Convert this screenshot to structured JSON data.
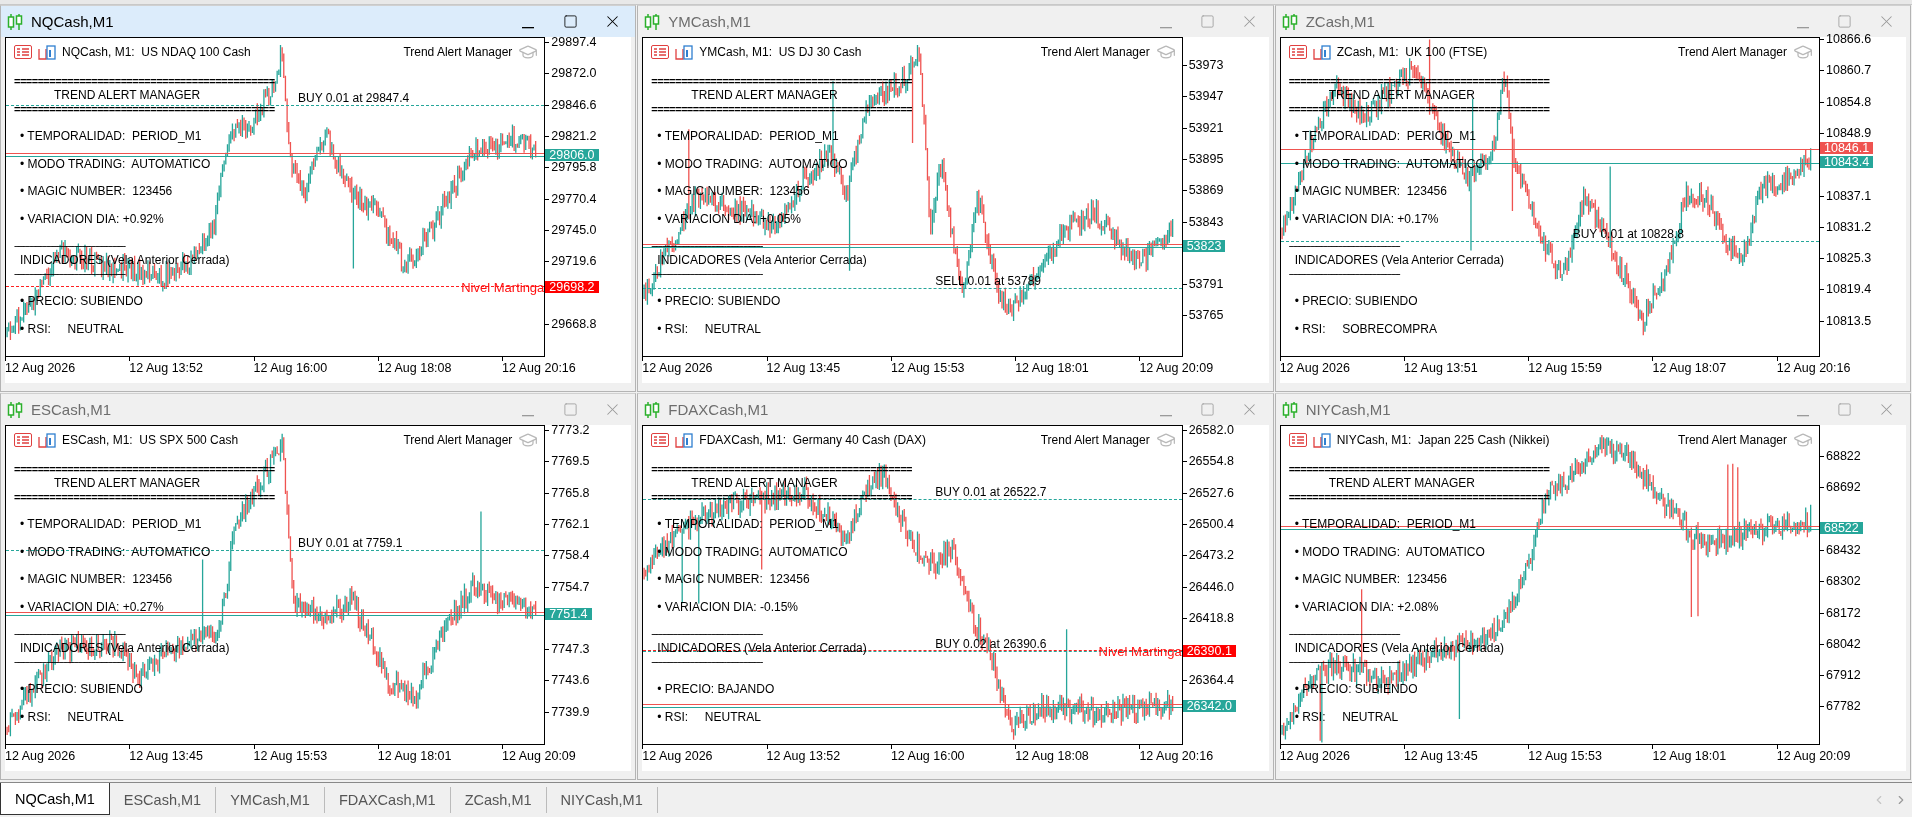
{
  "windows": [
    {
      "title": "NQCash,M1",
      "active": true,
      "symbol_line": "NQCash, M1:  US NDAQ 100 Cash",
      "expert": "Trend Alert Manager",
      "panel": {
        "rule": "============================================",
        "heading": "TREND ALERT MANAGER",
        "items": [
          "• TEMPORALIDAD:  PERIOD_M1",
          "• MODO TRADING:  AUTOMATICO",
          "• MAGIC NUMBER:  123456",
          "• VARIACION DIA: +0.92%"
        ],
        "dash_rule": "----------------------------------------------------",
        "section": "INDICADORES (Vela Anterior Cerrada)",
        "indicators": [
          "• PRECIO: SUBIENDO",
          "• RSI:     NEUTRAL"
        ]
      },
      "price_ticks": [
        "29897.4",
        "29872.0",
        "29846.6",
        "29821.2",
        "29795.8",
        "29770.4",
        "29745.0",
        "29719.6",
        "29668.8"
      ],
      "time_labels": [
        "12 Aug 2026",
        "12 Aug 13:52",
        "12 Aug 16:00",
        "12 Aug 18:08",
        "12 Aug 20:16"
      ],
      "levels": [
        {
          "kind": "trade",
          "label": "BUY 0.01 at 29847.4"
        },
        {
          "kind": "ask",
          "price": "29806.0"
        },
        {
          "kind": "martingale",
          "label": "Nivel Martinga",
          "price": "29698.2"
        }
      ]
    },
    {
      "title": "YMCash,M1",
      "active": false,
      "symbol_line": "YMCash, M1:  US DJ 30 Cash",
      "expert": "Trend Alert Manager",
      "panel": {
        "rule": "============================================",
        "heading": "TREND ALERT MANAGER",
        "items": [
          "• TEMPORALIDAD:  PERIOD_M1",
          "• MODO TRADING:  AUTOMATICO",
          "• MAGIC NUMBER:  123456",
          "• VARIACION DIA: +0.05%"
        ],
        "dash_rule": "----------------------------------------------------",
        "section": "INDICADORES (Vela Anterior Cerrada)",
        "indicators": [
          "• PRECIO: SUBIENDO",
          "• RSI:     NEUTRAL"
        ]
      },
      "price_ticks": [
        "53973",
        "53947",
        "53921",
        "53895",
        "53869",
        "53843",
        "53791",
        "53765"
      ],
      "time_labels": [
        "12 Aug 2026",
        "12 Aug 13:45",
        "12 Aug 15:53",
        "12 Aug 18:01",
        "12 Aug 20:09"
      ],
      "levels": [
        {
          "kind": "ask",
          "price": "53823"
        },
        {
          "kind": "trade",
          "label": "SELL 0.01 at 53789"
        }
      ]
    },
    {
      "title": "ZCash,M1",
      "active": false,
      "symbol_line": "ZCash, M1:  UK 100 (FTSE)",
      "expert": "Trend Alert Manager",
      "panel": {
        "rule": "============================================",
        "heading": "TREND ALERT MANAGER",
        "items": [
          "• TEMPORALIDAD:  PERIOD_M1",
          "• MODO TRADING:  AUTOMATICO",
          "• MAGIC NUMBER:  123456",
          "• VARIACION DIA: +0.17%"
        ],
        "dash_rule": "----------------------------------------------------",
        "section": "INDICADORES (Vela Anterior Cerrada)",
        "indicators": [
          "• PRECIO: SUBIENDO",
          "• RSI:     SOBRECOMPRA"
        ]
      },
      "price_ticks": [
        "10866.6",
        "10860.7",
        "10854.8",
        "10848.9",
        "10837.1",
        "10831.2",
        "10825.3",
        "10819.4",
        "10813.5"
      ],
      "time_labels": [
        "12 Aug 2026",
        "12 Aug 13:51",
        "12 Aug 15:59",
        "12 Aug 18:07",
        "12 Aug 20:16"
      ],
      "levels": [
        {
          "kind": "bid",
          "price": "10846.1"
        },
        {
          "kind": "ask",
          "price": "10843.4"
        },
        {
          "kind": "trade",
          "label": "BUY 0.01 at 10828.8"
        }
      ]
    },
    {
      "title": "ESCash,M1",
      "active": false,
      "symbol_line": "ESCash, M1:  US SPX 500 Cash",
      "expert": "Trend Alert Manager",
      "panel": {
        "rule": "============================================",
        "heading": "TREND ALERT MANAGER",
        "items": [
          "• TEMPORALIDAD:  PERIOD_M1",
          "• MODO TRADING:  AUTOMATICO",
          "• MAGIC NUMBER:  123456",
          "• VARIACION DIA: +0.27%"
        ],
        "dash_rule": "----------------------------------------------------",
        "section": "INDICADORES (Vela Anterior Cerrada)",
        "indicators": [
          "• PRECIO: SUBIENDO",
          "• RSI:     NEUTRAL"
        ]
      },
      "price_ticks": [
        "7773.2",
        "7769.5",
        "7765.8",
        "7762.1",
        "7758.4",
        "7754.7",
        "7747.3",
        "7743.6",
        "7739.9"
      ],
      "time_labels": [
        "12 Aug 2026",
        "12 Aug 13:45",
        "12 Aug 15:53",
        "12 Aug 18:01",
        "12 Aug 20:09"
      ],
      "levels": [
        {
          "kind": "trade",
          "label": "BUY 0.01 at 7759.1"
        },
        {
          "kind": "ask",
          "price": "7751.4"
        }
      ]
    },
    {
      "title": "FDAXCash,M1",
      "active": false,
      "symbol_line": "FDAXCash, M1:  Germany 40 Cash (DAX)",
      "expert": "Trend Alert Manager",
      "panel": {
        "rule": "============================================",
        "heading": "TREND ALERT MANAGER",
        "items": [
          "• TEMPORALIDAD:  PERIOD_M1",
          "• MODO TRADING:  AUTOMATICO",
          "• MAGIC NUMBER:  123456",
          "• VARIACION DIA: -0.15%"
        ],
        "dash_rule": "----------------------------------------------------",
        "section": "INDICADORES (Vela Anterior Cerrada)",
        "indicators": [
          "• PRECIO: BAJANDO",
          "• RSI:     NEUTRAL"
        ]
      },
      "price_ticks": [
        "26582.0",
        "26554.8",
        "26527.6",
        "26500.4",
        "26473.2",
        "26446.0",
        "26418.8",
        "26364.4"
      ],
      "time_labels": [
        "12 Aug 2026",
        "12 Aug 13:52",
        "12 Aug 16:00",
        "12 Aug 18:08",
        "12 Aug 20:16"
      ],
      "levels": [
        {
          "kind": "trade",
          "label": "BUY 0.01 at 26522.7"
        },
        {
          "kind": "trade",
          "label": "BUY 0.02 at 26390.6"
        },
        {
          "kind": "martingale",
          "label": "Nivel Martinga",
          "price": "26390.1"
        },
        {
          "kind": "ask",
          "price": "26342.0"
        }
      ]
    },
    {
      "title": "NIYCash,M1",
      "active": false,
      "symbol_line": "NIYCash, M1:  Japan 225 Cash (Nikkei)",
      "expert": "Trend Alert Manager",
      "panel": {
        "rule": "============================================",
        "heading": "TREND ALERT MANAGER",
        "items": [
          "• TEMPORALIDAD:  PERIOD_M1",
          "• MODO TRADING:  AUTOMATICO",
          "• MAGIC NUMBER:  123456",
          "• VARIACION DIA: +2.08%"
        ],
        "dash_rule": "----------------------------------------------------",
        "section": "INDICADORES (Vela Anterior Cerrada)",
        "indicators": [
          "• PRECIO: SUBIENDO",
          "• RSI:     NEUTRAL"
        ]
      },
      "price_ticks": [
        "68822",
        "68692",
        "68432",
        "68302",
        "68172",
        "68042",
        "67912",
        "67782"
      ],
      "time_labels": [
        "12 Aug 2026",
        "12 Aug 13:45",
        "12 Aug 15:53",
        "12 Aug 18:01",
        "12 Aug 20:09"
      ],
      "levels": [
        {
          "kind": "ask",
          "price": "68522"
        }
      ]
    }
  ],
  "tabs": [
    {
      "label": "NQCash,M1",
      "selected": true
    },
    {
      "label": "ESCash,M1",
      "selected": false
    },
    {
      "label": "YMCash,M1",
      "selected": false
    },
    {
      "label": "FDAXCash,M1",
      "selected": false
    },
    {
      "label": "ZCash,M1",
      "selected": false
    },
    {
      "label": "NIYCash,M1",
      "selected": false
    }
  ]
}
